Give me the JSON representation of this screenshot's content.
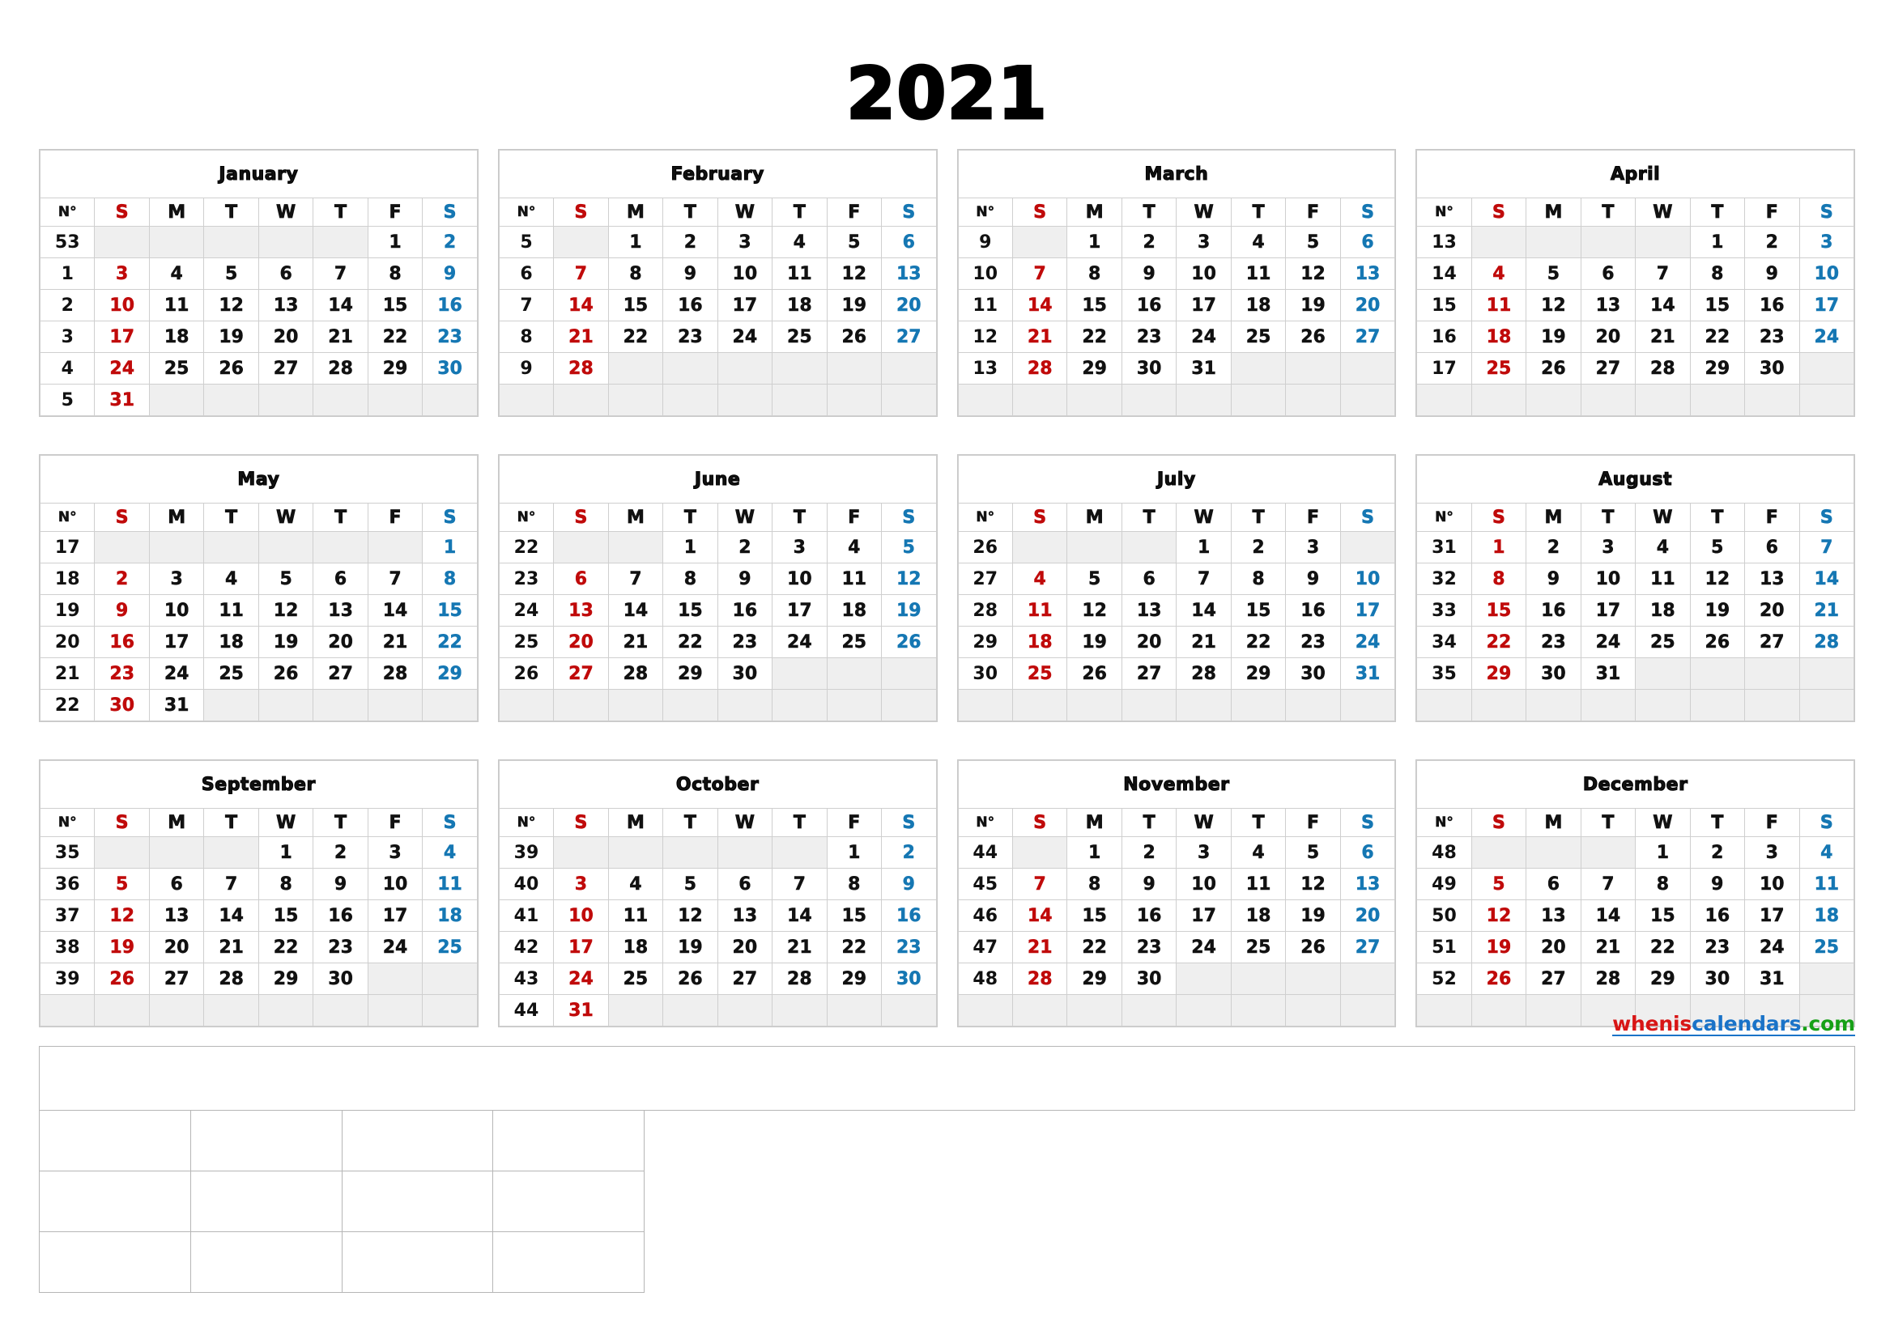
{
  "year_title": "2021",
  "weekday_headers": [
    "N°",
    "S",
    "M",
    "T",
    "W",
    "T",
    "F",
    "S"
  ],
  "colors": {
    "saturday": "#c00a0a",
    "sunday": "#1577b3",
    "empty_cell": "#efefef",
    "grid_line": "#cfcfcf",
    "text": "#111111"
  },
  "watermark": {
    "part1": "whenis",
    "part2": "calendars",
    "part3": ".com"
  },
  "months": [
    {
      "name": "January",
      "weeks": [
        {
          "no": "53",
          "days": [
            "",
            "",
            "",
            "",
            "",
            "1",
            "2"
          ]
        },
        {
          "no": "1",
          "days": [
            "3",
            "4",
            "5",
            "6",
            "7",
            "8",
            "9"
          ]
        },
        {
          "no": "2",
          "days": [
            "10",
            "11",
            "12",
            "13",
            "14",
            "15",
            "16"
          ]
        },
        {
          "no": "3",
          "days": [
            "17",
            "18",
            "19",
            "20",
            "21",
            "22",
            "23"
          ]
        },
        {
          "no": "4",
          "days": [
            "24",
            "25",
            "26",
            "27",
            "28",
            "29",
            "30"
          ]
        },
        {
          "no": "5",
          "days": [
            "31",
            "",
            "",
            "",
            "",
            "",
            ""
          ]
        }
      ]
    },
    {
      "name": "February",
      "weeks": [
        {
          "no": "5",
          "days": [
            "",
            "1",
            "2",
            "3",
            "4",
            "5",
            "6"
          ]
        },
        {
          "no": "6",
          "days": [
            "7",
            "8",
            "9",
            "10",
            "11",
            "12",
            "13"
          ]
        },
        {
          "no": "7",
          "days": [
            "14",
            "15",
            "16",
            "17",
            "18",
            "19",
            "20"
          ]
        },
        {
          "no": "8",
          "days": [
            "21",
            "22",
            "23",
            "24",
            "25",
            "26",
            "27"
          ]
        },
        {
          "no": "9",
          "days": [
            "28",
            "",
            "",
            "",
            "",
            "",
            ""
          ]
        },
        {
          "no": "",
          "days": [
            "",
            "",
            "",
            "",
            "",
            "",
            ""
          ]
        }
      ]
    },
    {
      "name": "March",
      "weeks": [
        {
          "no": "9",
          "days": [
            "",
            "1",
            "2",
            "3",
            "4",
            "5",
            "6"
          ]
        },
        {
          "no": "10",
          "days": [
            "7",
            "8",
            "9",
            "10",
            "11",
            "12",
            "13"
          ]
        },
        {
          "no": "11",
          "days": [
            "14",
            "15",
            "16",
            "17",
            "18",
            "19",
            "20"
          ]
        },
        {
          "no": "12",
          "days": [
            "21",
            "22",
            "23",
            "24",
            "25",
            "26",
            "27"
          ]
        },
        {
          "no": "13",
          "days": [
            "28",
            "29",
            "30",
            "31",
            "",
            "",
            ""
          ]
        },
        {
          "no": "",
          "days": [
            "",
            "",
            "",
            "",
            "",
            "",
            ""
          ]
        }
      ]
    },
    {
      "name": "April",
      "weeks": [
        {
          "no": "13",
          "days": [
            "",
            "",
            "",
            "",
            "1",
            "2",
            "3"
          ]
        },
        {
          "no": "14",
          "days": [
            "4",
            "5",
            "6",
            "7",
            "8",
            "9",
            "10"
          ]
        },
        {
          "no": "15",
          "days": [
            "11",
            "12",
            "13",
            "14",
            "15",
            "16",
            "17"
          ]
        },
        {
          "no": "16",
          "days": [
            "18",
            "19",
            "20",
            "21",
            "22",
            "23",
            "24"
          ]
        },
        {
          "no": "17",
          "days": [
            "25",
            "26",
            "27",
            "28",
            "29",
            "30",
            ""
          ]
        },
        {
          "no": "",
          "days": [
            "",
            "",
            "",
            "",
            "",
            "",
            ""
          ]
        }
      ]
    },
    {
      "name": "May",
      "weeks": [
        {
          "no": "17",
          "days": [
            "",
            "",
            "",
            "",
            "",
            "",
            "1"
          ]
        },
        {
          "no": "18",
          "days": [
            "2",
            "3",
            "4",
            "5",
            "6",
            "7",
            "8"
          ]
        },
        {
          "no": "19",
          "days": [
            "9",
            "10",
            "11",
            "12",
            "13",
            "14",
            "15"
          ]
        },
        {
          "no": "20",
          "days": [
            "16",
            "17",
            "18",
            "19",
            "20",
            "21",
            "22"
          ]
        },
        {
          "no": "21",
          "days": [
            "23",
            "24",
            "25",
            "26",
            "27",
            "28",
            "29"
          ]
        },
        {
          "no": "22",
          "days": [
            "30",
            "31",
            "",
            "",
            "",
            "",
            ""
          ]
        }
      ]
    },
    {
      "name": "June",
      "weeks": [
        {
          "no": "22",
          "days": [
            "",
            "",
            "1",
            "2",
            "3",
            "4",
            "5"
          ]
        },
        {
          "no": "23",
          "days": [
            "6",
            "7",
            "8",
            "9",
            "10",
            "11",
            "12"
          ]
        },
        {
          "no": "24",
          "days": [
            "13",
            "14",
            "15",
            "16",
            "17",
            "18",
            "19"
          ]
        },
        {
          "no": "25",
          "days": [
            "20",
            "21",
            "22",
            "23",
            "24",
            "25",
            "26"
          ]
        },
        {
          "no": "26",
          "days": [
            "27",
            "28",
            "29",
            "30",
            "",
            "",
            ""
          ]
        },
        {
          "no": "",
          "days": [
            "",
            "",
            "",
            "",
            "",
            "",
            ""
          ]
        }
      ]
    },
    {
      "name": "July",
      "weeks": [
        {
          "no": "26",
          "days": [
            "",
            "",
            "",
            "1",
            "2",
            "3",
            ""
          ]
        },
        {
          "no": "27",
          "days": [
            "4",
            "5",
            "6",
            "7",
            "8",
            "9",
            "10"
          ]
        },
        {
          "no": "28",
          "days": [
            "11",
            "12",
            "13",
            "14",
            "15",
            "16",
            "17"
          ]
        },
        {
          "no": "29",
          "days": [
            "18",
            "19",
            "20",
            "21",
            "22",
            "23",
            "24"
          ]
        },
        {
          "no": "30",
          "days": [
            "25",
            "26",
            "27",
            "28",
            "29",
            "30",
            "31"
          ]
        },
        {
          "no": "",
          "days": [
            "",
            "",
            "",
            "",
            "",
            "",
            ""
          ]
        }
      ]
    },
    {
      "name": "August",
      "weeks": [
        {
          "no": "31",
          "days": [
            "1",
            "2",
            "3",
            "4",
            "5",
            "6",
            "7"
          ]
        },
        {
          "no": "32",
          "days": [
            "8",
            "9",
            "10",
            "11",
            "12",
            "13",
            "14"
          ]
        },
        {
          "no": "33",
          "days": [
            "15",
            "16",
            "17",
            "18",
            "19",
            "20",
            "21"
          ]
        },
        {
          "no": "34",
          "days": [
            "22",
            "23",
            "24",
            "25",
            "26",
            "27",
            "28"
          ]
        },
        {
          "no": "35",
          "days": [
            "29",
            "30",
            "31",
            "",
            "",
            "",
            ""
          ]
        },
        {
          "no": "",
          "days": [
            "",
            "",
            "",
            "",
            "",
            "",
            ""
          ]
        }
      ]
    },
    {
      "name": "September",
      "weeks": [
        {
          "no": "35",
          "days": [
            "",
            "",
            "",
            "1",
            "2",
            "3",
            "4"
          ]
        },
        {
          "no": "36",
          "days": [
            "5",
            "6",
            "7",
            "8",
            "9",
            "10",
            "11"
          ]
        },
        {
          "no": "37",
          "days": [
            "12",
            "13",
            "14",
            "15",
            "16",
            "17",
            "18"
          ]
        },
        {
          "no": "38",
          "days": [
            "19",
            "20",
            "21",
            "22",
            "23",
            "24",
            "25"
          ]
        },
        {
          "no": "39",
          "days": [
            "26",
            "27",
            "28",
            "29",
            "30",
            "",
            ""
          ]
        },
        {
          "no": "",
          "days": [
            "",
            "",
            "",
            "",
            "",
            "",
            ""
          ]
        }
      ]
    },
    {
      "name": "October",
      "weeks": [
        {
          "no": "39",
          "days": [
            "",
            "",
            "",
            "",
            "",
            "1",
            "2"
          ]
        },
        {
          "no": "40",
          "days": [
            "3",
            "4",
            "5",
            "6",
            "7",
            "8",
            "9"
          ]
        },
        {
          "no": "41",
          "days": [
            "10",
            "11",
            "12",
            "13",
            "14",
            "15",
            "16"
          ]
        },
        {
          "no": "42",
          "days": [
            "17",
            "18",
            "19",
            "20",
            "21",
            "22",
            "23"
          ]
        },
        {
          "no": "43",
          "days": [
            "24",
            "25",
            "26",
            "27",
            "28",
            "29",
            "30"
          ]
        },
        {
          "no": "44",
          "days": [
            "31",
            "",
            "",
            "",
            "",
            "",
            ""
          ]
        }
      ]
    },
    {
      "name": "November",
      "weeks": [
        {
          "no": "44",
          "days": [
            "",
            "1",
            "2",
            "3",
            "4",
            "5",
            "6"
          ]
        },
        {
          "no": "45",
          "days": [
            "7",
            "8",
            "9",
            "10",
            "11",
            "12",
            "13"
          ]
        },
        {
          "no": "46",
          "days": [
            "14",
            "15",
            "16",
            "17",
            "18",
            "19",
            "20"
          ]
        },
        {
          "no": "47",
          "days": [
            "21",
            "22",
            "23",
            "24",
            "25",
            "26",
            "27"
          ]
        },
        {
          "no": "48",
          "days": [
            "28",
            "29",
            "30",
            "",
            "",
            "",
            ""
          ]
        },
        {
          "no": "",
          "days": [
            "",
            "",
            "",
            "",
            "",
            "",
            ""
          ]
        }
      ]
    },
    {
      "name": "December",
      "weeks": [
        {
          "no": "48",
          "days": [
            "",
            "",
            "",
            "1",
            "2",
            "3",
            "4"
          ]
        },
        {
          "no": "49",
          "days": [
            "5",
            "6",
            "7",
            "8",
            "9",
            "10",
            "11"
          ]
        },
        {
          "no": "50",
          "days": [
            "12",
            "13",
            "14",
            "15",
            "16",
            "17",
            "18"
          ]
        },
        {
          "no": "51",
          "days": [
            "19",
            "20",
            "21",
            "22",
            "23",
            "24",
            "25"
          ]
        },
        {
          "no": "52",
          "days": [
            "26",
            "27",
            "28",
            "29",
            "30",
            "31",
            ""
          ]
        },
        {
          "no": "",
          "days": [
            "",
            "",
            "",
            "",
            "",
            "",
            ""
          ]
        }
      ]
    }
  ],
  "notes_table": {
    "rows": 4,
    "columns_per_row": [
      1,
      4,
      4,
      4
    ],
    "cells": [
      [
        ""
      ],
      [
        "",
        "",
        "",
        ""
      ],
      [
        "",
        "",
        "",
        ""
      ],
      [
        "",
        "",
        "",
        ""
      ]
    ]
  }
}
